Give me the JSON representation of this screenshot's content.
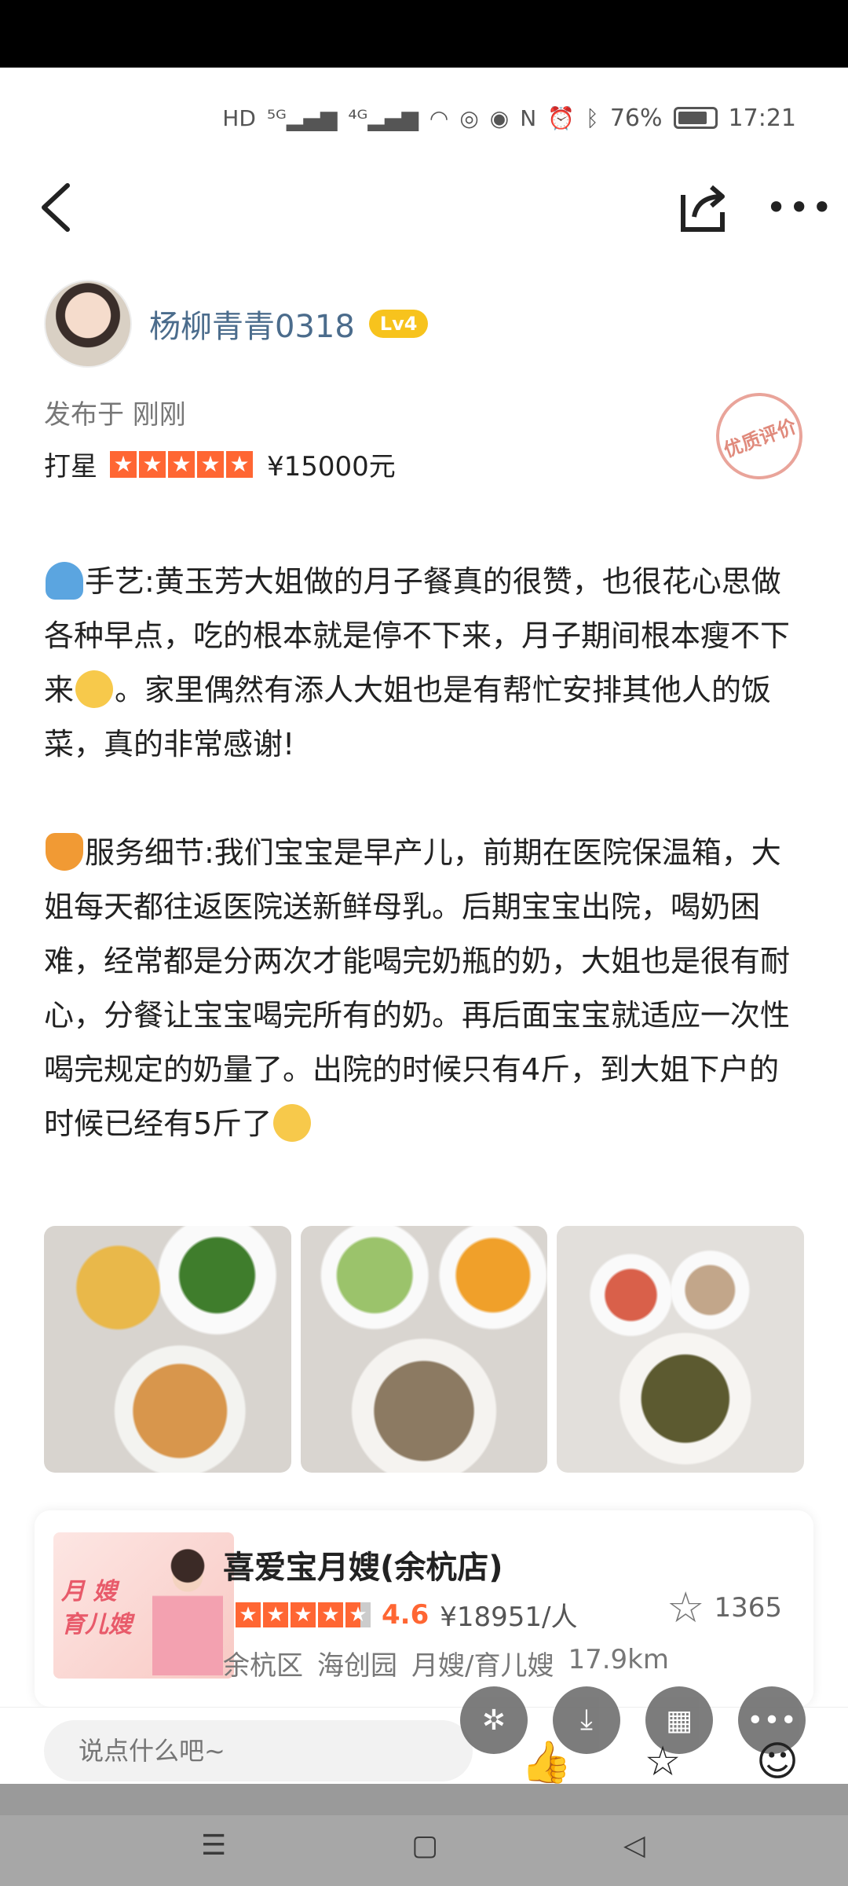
{
  "status_bar": {
    "battery": "76%",
    "time": "17:21"
  },
  "author": {
    "name": "杨柳青青0318",
    "level": "Lv4"
  },
  "post": {
    "published": "发布于 刚刚",
    "rating_label": "打星",
    "stars": 5,
    "price": "¥15000元",
    "quality_badge": "优质评价",
    "paragraph1": "手艺:黄玉芳大姐做的月子餐真的很赞，也很花心思做各种早点，吃的根本就是停不下来，月子期间根本瘦不下来",
    "paragraph1_tail": "。家里偶然有添人大姐也是有帮忙安排其他人的饭菜，真的非常感谢!",
    "paragraph2": "服务细节:我们宝宝是早产儿，前期在医院保温箱，大姐每天都往返医院送新鲜母乳。后期宝宝出院，喝奶困难，经常都是分两次才能喝完奶瓶的奶，大姐也是很有耐心，分餐让宝宝喝完所有的奶。再后面宝宝就适应一次性喝完规定的奶量了。出院的时候只有4斤，到大姐下户的时候已经有5斤了"
  },
  "shop": {
    "name": "喜爱宝月嫂(余杭店)",
    "thumb_line1": "月 嫂",
    "thumb_line2": "育儿嫂",
    "score": "4.6",
    "avg_price": "¥18951/人",
    "favorites": "1365",
    "district": "余杭区",
    "area": "海创园",
    "category": "月嫂/育儿嫂",
    "distance": "17.9km"
  },
  "bottom": {
    "comment_placeholder": "说点什么吧~"
  },
  "colors": {
    "accent": "#ff6633",
    "author_name": "#4b6c8c",
    "lv_badge": "#f7c31d"
  }
}
